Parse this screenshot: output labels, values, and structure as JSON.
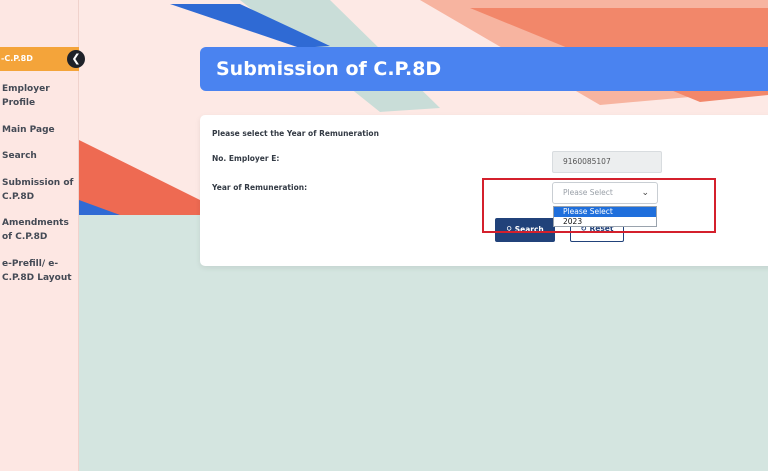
{
  "sidebar": {
    "active_label": "-C.P.8D",
    "items": [
      "Employer Profile",
      "Main Page",
      "Search",
      "Submission of C.P.8D",
      "Amendments of C.P.8D",
      "e-Prefill/ e-C.P.8D Layout"
    ]
  },
  "header": {
    "title": "Submission of C.P.8D"
  },
  "form": {
    "prompt": "Please select the Year of Remuneration",
    "employer_label": "No. Employer E:",
    "employer_value": "9160085107",
    "year_label": "Year of Remuneration:",
    "year_placeholder": "Please Select",
    "year_options": [
      "Please Select",
      "2023"
    ],
    "search_label": "Search",
    "reset_label": "Reset"
  },
  "colors": {
    "header": "#4a83f0",
    "button": "#21427a",
    "sidebar_active": "#f4a43a",
    "highlight": "#d4202c"
  }
}
